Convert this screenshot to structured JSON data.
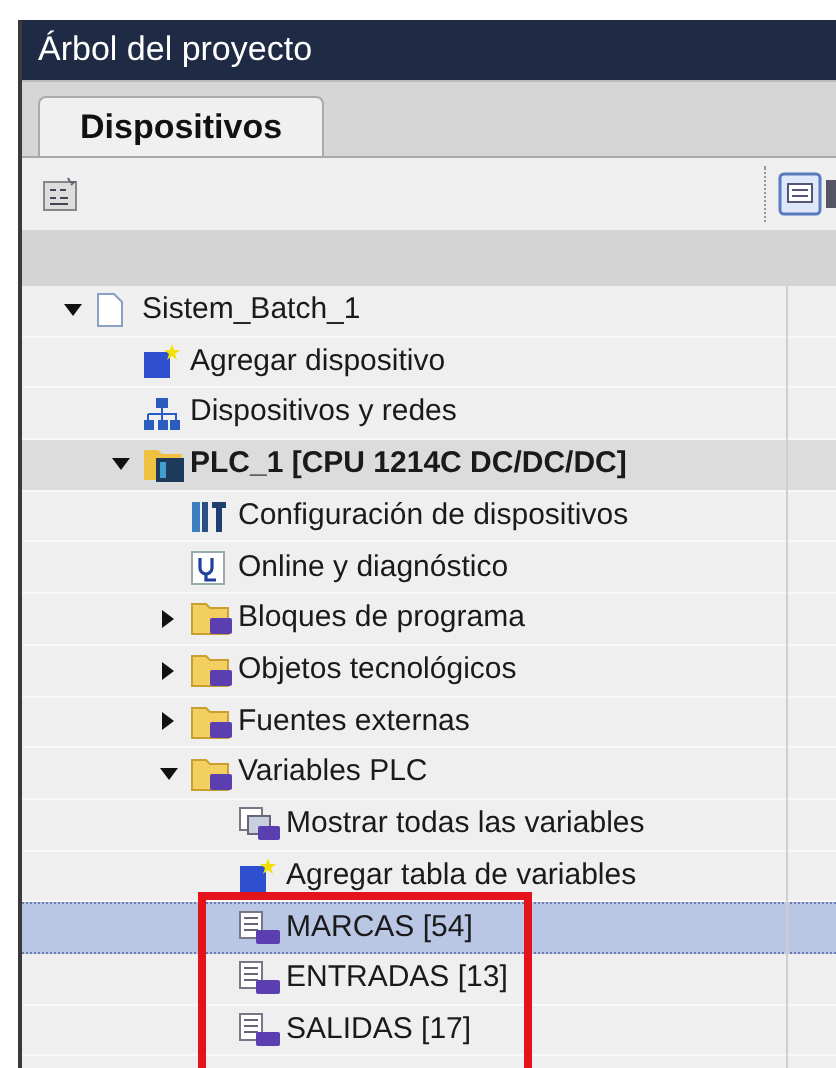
{
  "panel": {
    "title": "Árbol del proyecto"
  },
  "tabs": [
    {
      "label": "Dispositivos",
      "selected": true
    }
  ],
  "tree": [
    {
      "label": "Sistem_Batch_1",
      "kind": "project",
      "expanded": true,
      "selected": false,
      "children": [
        {
          "label": "Agregar dispositivo",
          "kind": "add",
          "selected": false
        },
        {
          "label": "Dispositivos y redes",
          "kind": "network",
          "selected": false
        },
        {
          "label": "PLC_1 [CPU 1214C DC/DC/DC]",
          "kind": "plc",
          "expanded": true,
          "selected": false,
          "children": [
            {
              "label": "Configuración de dispositivos",
              "kind": "config",
              "selected": false
            },
            {
              "label": "Online y diagnóstico",
              "kind": "online",
              "selected": false
            },
            {
              "label": "Bloques de programa",
              "kind": "folder",
              "expanded": false,
              "selected": false
            },
            {
              "label": "Objetos tecnológicos",
              "kind": "folder",
              "expanded": false,
              "selected": false
            },
            {
              "label": "Fuentes externas",
              "kind": "folder",
              "expanded": false,
              "selected": false
            },
            {
              "label": "Variables PLC",
              "kind": "folder",
              "expanded": true,
              "selected": false,
              "children": [
                {
                  "label": "Mostrar todas las variables",
                  "kind": "tags",
                  "selected": false
                },
                {
                  "label": "Agregar tabla de variables",
                  "kind": "add",
                  "selected": false
                },
                {
                  "label": "MARCAS [54]",
                  "kind": "table",
                  "selected": true
                },
                {
                  "label": "ENTRADAS [13]",
                  "kind": "table",
                  "selected": false
                },
                {
                  "label": "SALIDAS [17]",
                  "kind": "table",
                  "selected": false
                }
              ]
            }
          ]
        }
      ]
    }
  ],
  "annotation": {
    "kind": "box",
    "color": "#e3121b"
  }
}
